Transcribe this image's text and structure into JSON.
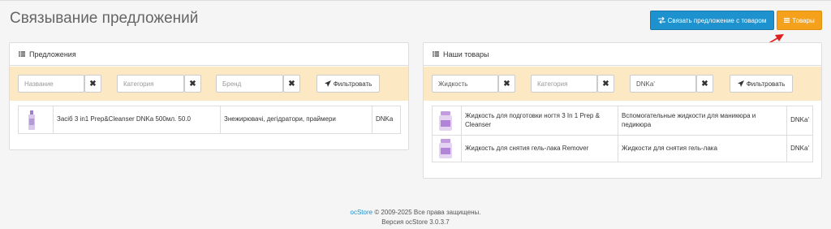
{
  "page": {
    "title": "Связывание предложений"
  },
  "header_buttons": {
    "link_offer_label": "Связать предложение с товаром",
    "products_label": "Товары"
  },
  "offers_panel": {
    "title": "Предложения",
    "filter": {
      "name_placeholder": "Название",
      "category_placeholder": "Категория",
      "brand_placeholder": "Бренд",
      "filter_label": "Фильтровать"
    },
    "rows": [
      {
        "name": "Засіб 3 in1 Prep&Cleanser DNKa 500мл. 50.0",
        "category": "Знежирювачі, дегідратори, праймери",
        "brand": "DNKa"
      }
    ]
  },
  "products_panel": {
    "title": "Наши товары",
    "filter": {
      "name_value": "Жидкость",
      "category_placeholder": "Категория",
      "brand_value": "DNKa'",
      "filter_label": "Фильтровать"
    },
    "rows": [
      {
        "name": "Жидкость для подготовки ногтя 3 In 1 Prep & Cleanser",
        "category": "Вспомогательные жидкости для маникюра и педикюра",
        "brand": "DNKa'"
      },
      {
        "name": "Жидкость для снятия гель-лака Remover",
        "category": "Жидкости для снятия гель-лака",
        "brand": "DNKa'"
      }
    ]
  },
  "footer": {
    "brand_link": "ocStore",
    "copyright": "© 2009-2025 Все права защищены.",
    "version": "Версия ocStore 3.0.3.7"
  },
  "colors": {
    "primary": "#1e91cf",
    "warning": "#f6a11b",
    "filter_bg": "#fde8c4",
    "arrow": "#e02020"
  }
}
